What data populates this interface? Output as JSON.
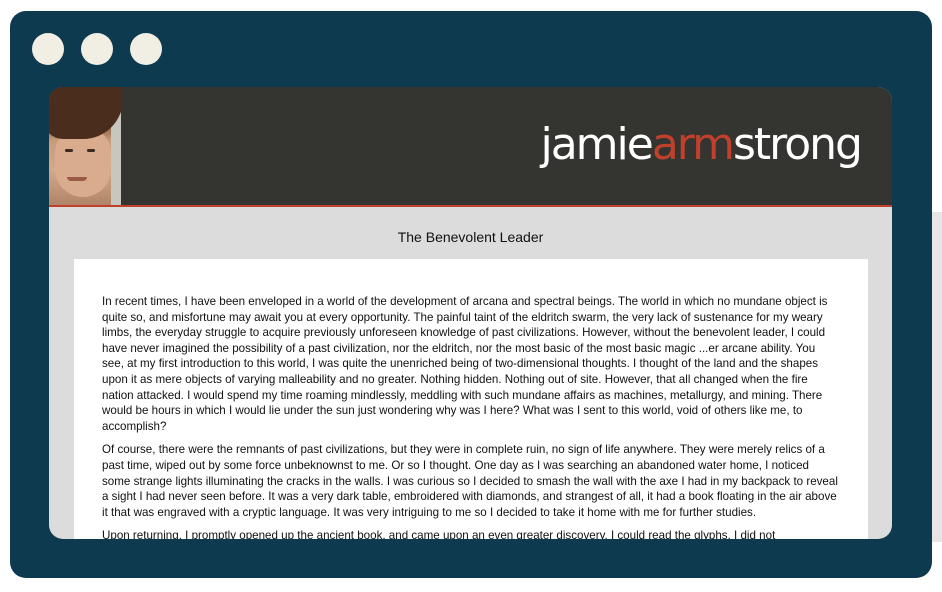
{
  "window": {
    "controls": [
      "dot",
      "dot",
      "dot"
    ]
  },
  "site": {
    "brand_first": "jamie",
    "brand_accent": "arm",
    "brand_last": "strong",
    "brand_accent_color": "#c0402b",
    "header_color": "#343430"
  },
  "post": {
    "title": "The Benevolent Leader",
    "paragraphs": [
      "In recent times, I have been enveloped in a world of the development of arcana and spectral beings. The world in which no mundane object is quite so, and misfortune may await you at every opportunity. The painful taint of the eldritch swarm, the very lack of sustenance for my weary limbs, the everyday struggle to acquire previously unforeseen knowledge of past civilizations. However, without the benevolent leader, I could have never imagined the possibility of a past civilization, nor the eldritch, nor the most basic of the most basic magic ...er arcane ability. You see, at my first introduction to this world, I was quite the unenriched being of two-dimensional thoughts. I thought of the land and the shapes upon it as mere objects of varying malleability and no greater. Nothing hidden. Nothing out of site. However, that all changed when the fire nation attacked. I would spend my time roaming mindlessly, meddling with such mundane affairs as machines, metallurgy, and mining. There would be hours in which I would lie under the sun just wondering why was I here? What was I sent to this world, void of others like me, to accomplish?",
      "Of course, there were the remnants of past civilizations, but they were in complete ruin, no sign of life anywhere. They were merely relics of a past time, wiped out by some force unbeknownst to me. Or so I thought. One day as I was searching an abandoned water home, I noticed some strange lights illuminating the cracks in the walls. I was curious so I decided to smash the wall with the axe I had in my backpack to reveal a sight I had never seen before. It was a very dark table, embroidered with diamonds, and strangest of all, it had a book floating in the air above it that was engraved with a cryptic language. It was very intriguing to me so I decided to take it home with me for further studies.",
      "Upon returning, I promptly opened up the ancient book, and came upon an even greater discovery. I could read the glyphs. I did not"
    ]
  }
}
